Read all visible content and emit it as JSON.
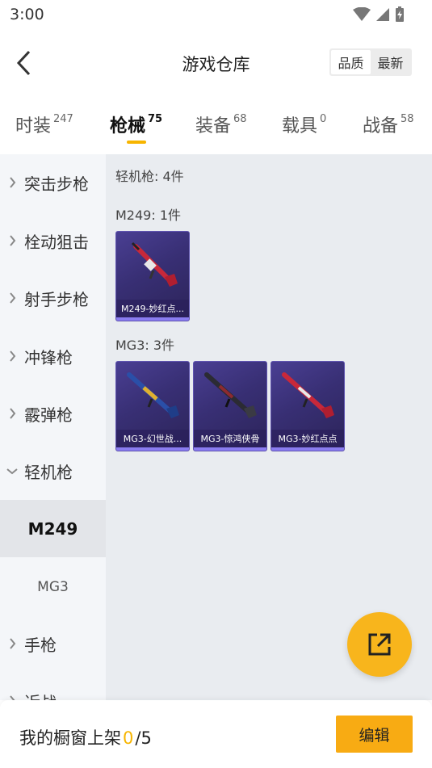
{
  "status_bar": {
    "time": "3:00"
  },
  "header": {
    "title": "游戏仓库",
    "sort_quality": "品质",
    "sort_newest": "最新"
  },
  "tabs": [
    {
      "label": "时装",
      "count": "247"
    },
    {
      "label": "枪械",
      "count": "75"
    },
    {
      "label": "装备",
      "count": "68"
    },
    {
      "label": "载具",
      "count": "0"
    },
    {
      "label": "战备",
      "count": "58"
    }
  ],
  "sidebar": {
    "items": [
      {
        "label": "突击步枪"
      },
      {
        "label": "栓动狙击"
      },
      {
        "label": "射手步枪"
      },
      {
        "label": "冲锋枪"
      },
      {
        "label": "霰弹枪"
      },
      {
        "label": "轻机枪"
      },
      {
        "label": "M249"
      },
      {
        "label": "MG3"
      },
      {
        "label": "手枪"
      },
      {
        "label": "近战"
      }
    ]
  },
  "content": {
    "category_title": "轻机枪: 4件",
    "groups": [
      {
        "title": "M249: 1件",
        "items": [
          {
            "name": "M249-妙红点..."
          }
        ]
      },
      {
        "title": "MG3: 3件",
        "items": [
          {
            "name": "MG3-幻世战..."
          },
          {
            "name": "MG3-惊鸿侠骨"
          },
          {
            "name": "MG3-妙红点点"
          }
        ]
      }
    ]
  },
  "bottom_bar": {
    "shelf_label": "我的橱窗上架",
    "shelf_used": "0",
    "shelf_sep": "/",
    "shelf_total": "5",
    "edit_label": "编辑"
  },
  "colors": {
    "accent": "#f7b500",
    "button": "#f8ab13",
    "card": "#3a3078"
  }
}
